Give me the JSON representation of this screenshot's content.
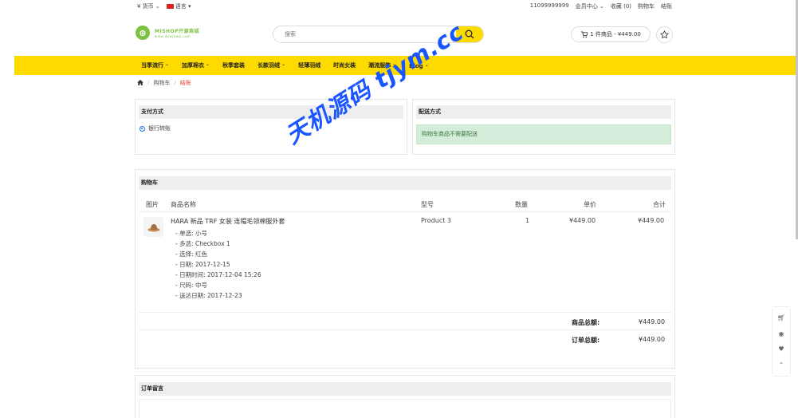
{
  "topbar": {
    "currency": "¥ 货币",
    "language": "语言",
    "phone": "11099999999",
    "links": [
      "会员中心",
      "收藏 (0)",
      "购物车",
      "结账"
    ]
  },
  "header": {
    "logo_title": "MISHOP开源商城",
    "logo_sub": "www.dswinwa.com",
    "search_placeholder": "搜索",
    "cart_summary": "1 件商品 - ¥449.00"
  },
  "menu": [
    {
      "label": "当季流行",
      "caret": true
    },
    {
      "label": "加厚棉衣",
      "caret": true
    },
    {
      "label": "秋季套装",
      "caret": false
    },
    {
      "label": "长款羽绒",
      "caret": true
    },
    {
      "label": "轻薄羽绒",
      "caret": false
    },
    {
      "label": "时尚女装",
      "caret": false
    },
    {
      "label": "潮流服饰",
      "caret": true
    },
    {
      "label": "Blog",
      "caret": true
    }
  ],
  "breadcrumb": {
    "cart": "购物车",
    "current": "结账"
  },
  "payment": {
    "title": "支付方式",
    "option": "银行转账"
  },
  "shipping": {
    "title": "配送方式",
    "notice": "购物车商品不需要配送"
  },
  "cart": {
    "title": "购物车",
    "headers": {
      "image": "图片",
      "name": "商品名称",
      "model": "型号",
      "quantity": "数量",
      "unit_price": "单价",
      "total": "合计"
    },
    "item": {
      "name": "HARA 新品 TRF 女装 连帽毛领棉服外套",
      "options": [
        "- 单选: 小号",
        "- 多选: Checkbox 1",
        "- 选择: 红色",
        "- 日期: 2017-12-15",
        "- 日期时间: 2017-12-04 15:26",
        "- 尺码: 中号",
        "- 送达日期: 2017-12-23"
      ],
      "model": "Product 3",
      "quantity": "1",
      "unit_price": "¥449.00",
      "total": "¥449.00"
    },
    "totals": [
      {
        "label": "商品总额:",
        "value": "¥449.00"
      },
      {
        "label": "订单总额:",
        "value": "¥449.00"
      }
    ]
  },
  "comment": {
    "title": "订单留言"
  },
  "watermark": "天机源码 tjym.cc",
  "colors": {
    "accent": "#fedb00",
    "logo": "#7cc242",
    "link_active": "#e6472f",
    "success_bg": "#d4edda"
  }
}
